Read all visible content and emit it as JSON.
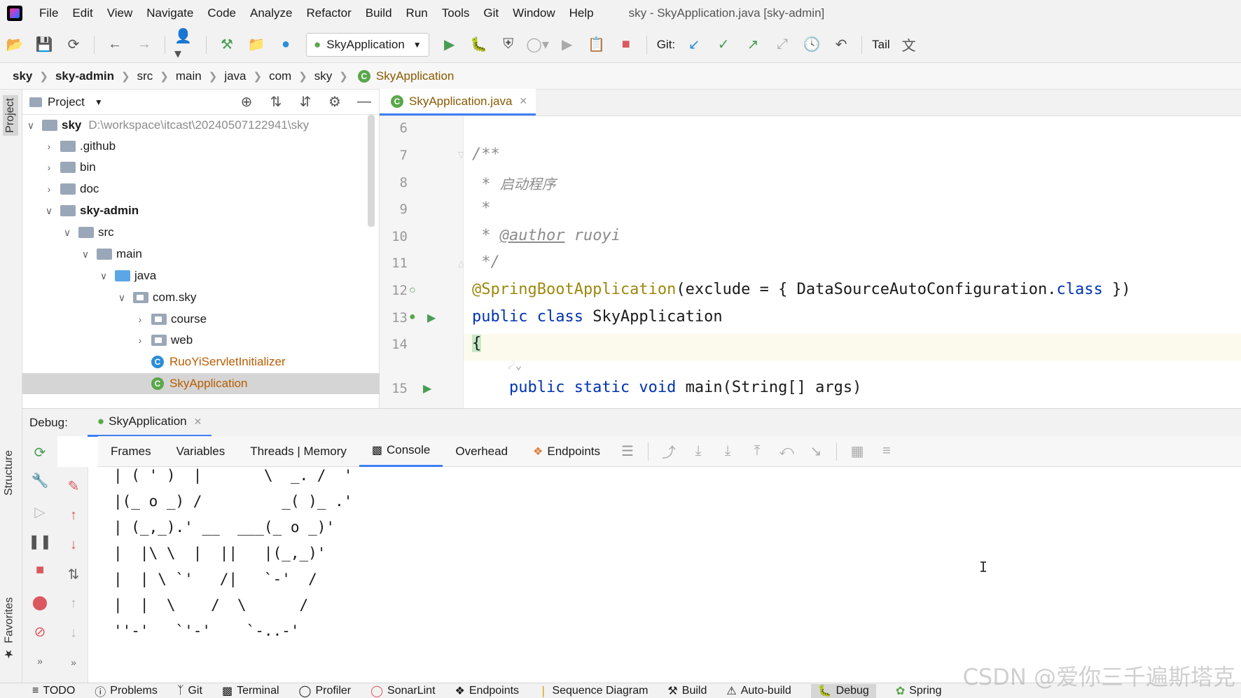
{
  "menu": {
    "items": [
      "File",
      "Edit",
      "View",
      "Navigate",
      "Code",
      "Analyze",
      "Refactor",
      "Build",
      "Run",
      "Tools",
      "Git",
      "Window",
      "Help"
    ],
    "window_title": "sky - SkyApplication.java [sky-admin]"
  },
  "toolbar": {
    "run_config": "SkyApplication",
    "git_label": "Git:",
    "tail_label": "Tail"
  },
  "breadcrumb": [
    "sky",
    "sky-admin",
    "src",
    "main",
    "java",
    "com",
    "sky",
    "SkyApplication"
  ],
  "left_strip": {
    "project": "Project",
    "structure": "Structure",
    "favorites": "Favorites"
  },
  "project_panel": {
    "title": "Project",
    "tree": [
      {
        "label": "sky",
        "path": "D:\\workspace\\itcast\\20240507122941\\sky"
      },
      {
        "label": ".github"
      },
      {
        "label": "bin"
      },
      {
        "label": "doc"
      },
      {
        "label": "sky-admin"
      },
      {
        "label": "src"
      },
      {
        "label": "main"
      },
      {
        "label": "java"
      },
      {
        "label": "com.sky"
      },
      {
        "label": "course"
      },
      {
        "label": "web"
      },
      {
        "label": "RuoYiServletInitializer"
      },
      {
        "label": "SkyApplication"
      }
    ]
  },
  "editor": {
    "tab": "SkyApplication.java",
    "line_numbers": [
      "6",
      "7",
      "8",
      "9",
      "10",
      "11",
      "12",
      "13",
      "14",
      "15"
    ],
    "code": {
      "l7": "/**",
      "l8_star": " * ",
      "l8_text": "启动程序",
      "l9": " *",
      "l10_star": " * ",
      "l10_tag": "@author",
      "l10_name": " ruoyi",
      "l11": " */",
      "l12_ann": "@SpringBootApplication",
      "l12_rest": "(exclude = { DataSourceAutoConfiguration.",
      "l12_kw": "class",
      "l12_end": " })",
      "l13_kw": "public class",
      "l13_name": " SkyApplication",
      "l14": "{",
      "l15_kw": "    public static void",
      "l15_rest": " main(String[] args)"
    }
  },
  "debug": {
    "label": "Debug:",
    "session": "SkyApplication",
    "tabs": [
      "Frames",
      "Variables",
      "Threads | Memory",
      "Console",
      "Overhead",
      "Endpoints"
    ],
    "active_tab": "Console",
    "console_lines": [
      "| ( ' )  |       \\  _. /  '",
      "|(_ o _) /         _( )_ .'",
      "| (_,_).' __  ___(_ o _)'",
      "|  |\\ \\  |  ||   |(_,_)'",
      "|  | \\ `'   /|   `-'  /",
      "|  |  \\    /  \\      /",
      "''-'   `'-'    `-..-'"
    ]
  },
  "statusbar": {
    "items": [
      "TODO",
      "Problems",
      "Git",
      "Terminal",
      "Profiler",
      "SonarLint",
      "Endpoints",
      "Sequence Diagram",
      "Build",
      "Auto-build",
      "Debug",
      "Spring"
    ],
    "active": "Debug"
  },
  "watermark": "CSDN @爱你三千遍斯塔克",
  "colors": {
    "accent": "#3f7ff5",
    "keyword": "#0033b3",
    "annotation": "#9e880d",
    "run_green": "#499c54",
    "stop_red": "#db5860"
  }
}
